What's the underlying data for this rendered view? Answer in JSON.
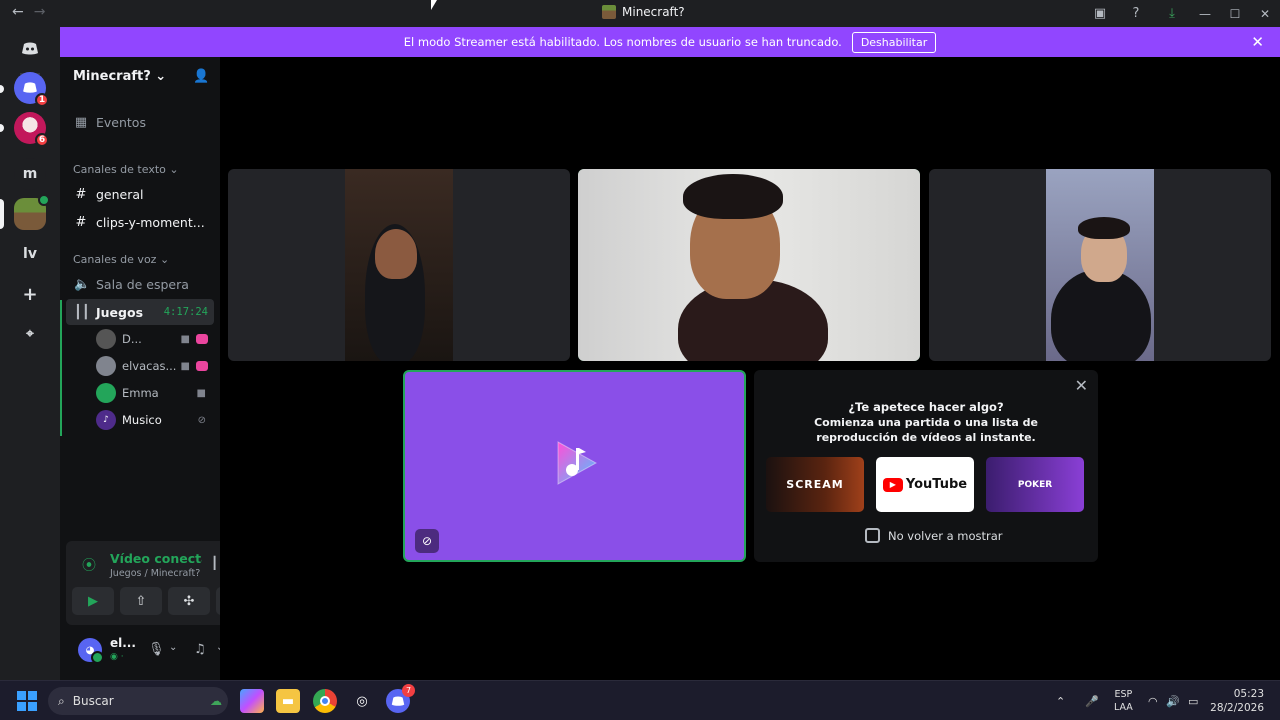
{
  "window": {
    "title": "Minecraft?",
    "nav_back": "←",
    "nav_forward": "→",
    "icons": [
      "inbox-icon",
      "help-icon",
      "download-icon"
    ],
    "controls": {
      "minimize": "—",
      "maximize": "☐",
      "close": "✕"
    }
  },
  "banner": {
    "text": "El modo Streamer está habilitado. Los nombres de usuario se han truncado.",
    "button": "Deshabilitar",
    "close": "✕",
    "color": "#9146ff"
  },
  "rail": {
    "servers": [
      {
        "label": "",
        "badge": "1"
      },
      {
        "label": "",
        "badge": "6"
      },
      {
        "label": "m",
        "badge": ""
      },
      {
        "label": "",
        "badge": ""
      },
      {
        "label": "lv",
        "badge": ""
      },
      {
        "label": "+",
        "badge": ""
      },
      {
        "label": "⌖",
        "badge": ""
      }
    ]
  },
  "sidebar": {
    "guild_name": "Minecraft?",
    "guild_chevron": "⌄",
    "events": "Eventos",
    "text_category": "Canales de texto",
    "text_channels": [
      "general",
      "clips-y-moment..."
    ],
    "voice_category": "Canales de voz",
    "voice_channels": [
      {
        "name": "Sala de espera",
        "timer": ""
      },
      {
        "name": "Juegos",
        "timer": "4:17:24"
      }
    ],
    "voice_users": [
      {
        "name": "D...",
        "avatar": ""
      },
      {
        "name": "elvacas...",
        "avatar": ""
      },
      {
        "name": "Emma",
        "avatar": ""
      },
      {
        "name": "Musico",
        "avatar": "♪"
      }
    ]
  },
  "voice_panel": {
    "status": "Vídeo conectado",
    "location": "Juegos / Minecraft?"
  },
  "user": {
    "name": "el...",
    "status": "◉ ·"
  },
  "activity": {
    "prompt_title": "¿Te apetece hacer algo?",
    "prompt_body": "Comienza una partida o una lista de reproducción de vídeos al instante.",
    "cards": [
      "SCREAM",
      "YouTube",
      "POKER"
    ],
    "dont_show": "No volver a mostrar",
    "close": "✕"
  },
  "taskbar": {
    "search_placeholder": "Buscar",
    "discord_badge": "7",
    "lang_top": "ESP",
    "lang_bottom": "LAA",
    "time": "05:23",
    "date": "28/2/2026"
  },
  "colors": {
    "accent": "#5865f2",
    "green": "#23a55a",
    "activity_bg": "#8a4fe8"
  }
}
